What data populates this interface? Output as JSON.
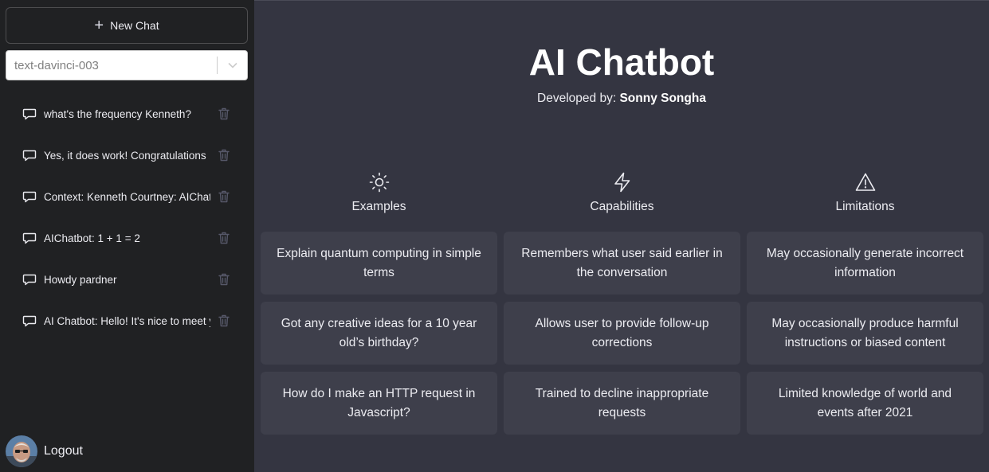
{
  "sidebar": {
    "new_chat": "New Chat",
    "model_select": {
      "value": "text-davinci-003"
    },
    "chats": [
      {
        "label": "what's the frequency Kenneth?"
      },
      {
        "label": "Yes, it does work! Congratulations"
      },
      {
        "label": "Context: Kenneth Courtney: AIChatbot"
      },
      {
        "label": "AIChatbot: 1 + 1 = 2"
      },
      {
        "label": "Howdy pardner"
      },
      {
        "label": "AI Chatbot: Hello! It's nice to meet you"
      }
    ],
    "logout": "Logout"
  },
  "main": {
    "title": "AI Chatbot",
    "subtitle_prefix": "Developed by:",
    "subtitle_name": "Sonny Songha",
    "columns": [
      {
        "heading": "Examples",
        "icon": "sun-icon",
        "cards": [
          "Explain quantum computing in simple terms",
          "Got any creative ideas for a 10 year old’s birthday?",
          "How do I make an HTTP request in Javascript?"
        ]
      },
      {
        "heading": "Capabilities",
        "icon": "lightning-icon",
        "cards": [
          "Remembers what user said earlier in the conversation",
          "Allows user to provide follow-up corrections",
          "Trained to decline inappropriate requests"
        ]
      },
      {
        "heading": "Limitations",
        "icon": "warning-icon",
        "cards": [
          "May occasionally generate incorrect information",
          "May occasionally produce harmful instructions or biased content",
          "Limited knowledge of world and events after 2021"
        ]
      }
    ]
  },
  "colors": {
    "sidebar_bg": "#202123",
    "main_bg": "#343541",
    "card_bg": "#3e3f4b",
    "text": "#ececf1"
  }
}
